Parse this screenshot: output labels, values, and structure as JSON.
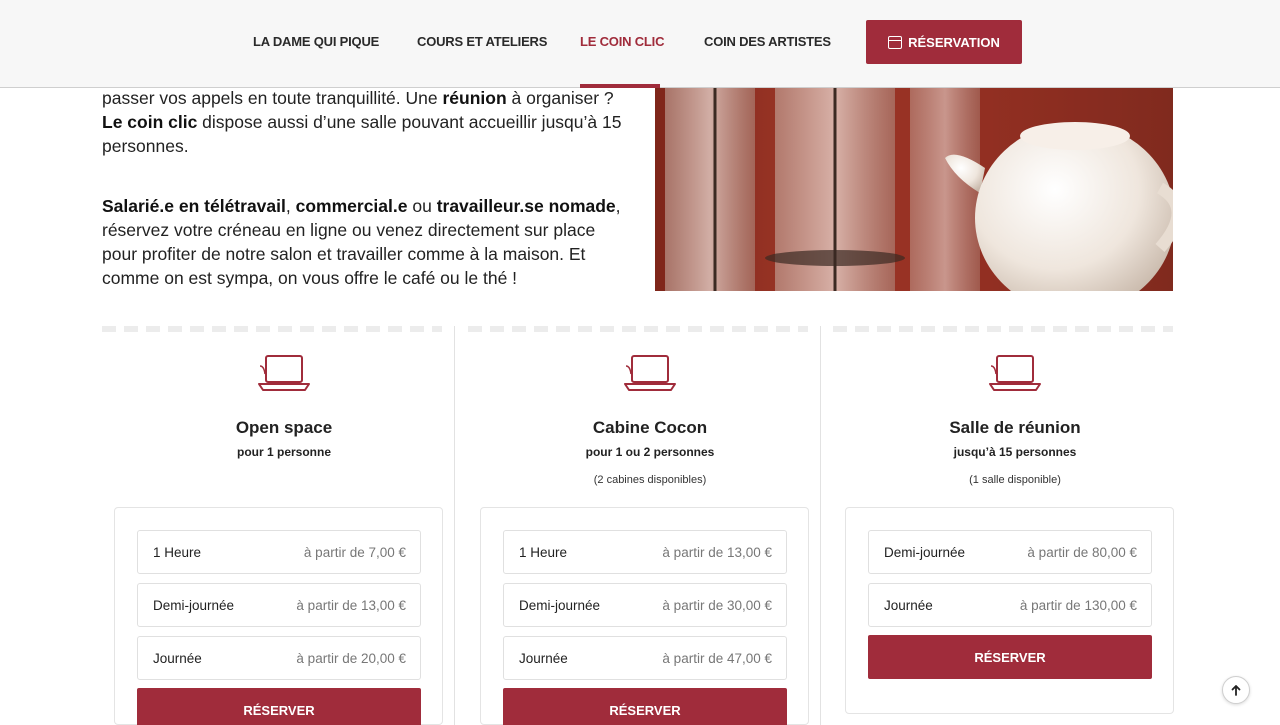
{
  "nav": {
    "items": [
      {
        "label": "LA DAME QUI PIQUE"
      },
      {
        "label": "COURS ET ATELIERS"
      },
      {
        "label": "LE COIN CLIC"
      },
      {
        "label": "COIN DES ARTISTES"
      }
    ],
    "reservation_label": "Réservation"
  },
  "intro": {
    "p1": [
      {
        "t": "passer vos appels en toute tranquillité. Une ",
        "b": false
      },
      {
        "t": "réunion",
        "b": true
      },
      {
        "t": " à organiser ? ",
        "b": false
      },
      {
        "t": "Le coin clic",
        "b": true
      },
      {
        "t": " dispose aussi d’une salle pouvant accueillir jusqu’à 15 personnes.",
        "b": false
      }
    ],
    "p2": [
      {
        "t": "Salarié.e en télétravail",
        "b": true
      },
      {
        "t": ", ",
        "b": false
      },
      {
        "t": "commercial.e",
        "b": true
      },
      {
        "t": " ou ",
        "b": false
      },
      {
        "t": "travailleur.se nomade",
        "b": true
      },
      {
        "t": ", réservez votre créneau en ligne ou venez directement sur place pour profiter de notre salon et travailler comme à la maison. Et comme on est sympa, on vous offre le café ou le thé !",
        "b": false
      }
    ]
  },
  "offers": [
    {
      "title": "Open space",
      "subtitle": "pour 1 personne",
      "note": "",
      "rows": [
        {
          "label": "1 Heure",
          "price": "à partir de 7,00 €"
        },
        {
          "label": "Demi-journée",
          "price": "à partir de 13,00 €"
        },
        {
          "label": "Journée",
          "price": "à partir de 20,00 €"
        }
      ],
      "button": "Réserver"
    },
    {
      "title": "Cabine Cocon",
      "subtitle": "pour 1 ou 2 personnes",
      "note": "(2 cabines disponibles)",
      "rows": [
        {
          "label": "1 Heure",
          "price": "à partir de 13,00 €"
        },
        {
          "label": "Demi-journée",
          "price": "à partir de 30,00 €"
        },
        {
          "label": "Journée",
          "price": "à partir de 47,00 €"
        }
      ],
      "button": "Réserver"
    },
    {
      "title": "Salle de réunion",
      "subtitle": "jusqu’à 15 personnes",
      "note": "(1 salle disponible)",
      "rows": [
        {
          "label": "Demi-journée",
          "price": "à partir de 80,00 €"
        },
        {
          "label": "Journée",
          "price": "à partir de 130,00 €"
        }
      ],
      "button": "Réserver"
    }
  ],
  "colors": {
    "accent": "#a02c3b"
  }
}
